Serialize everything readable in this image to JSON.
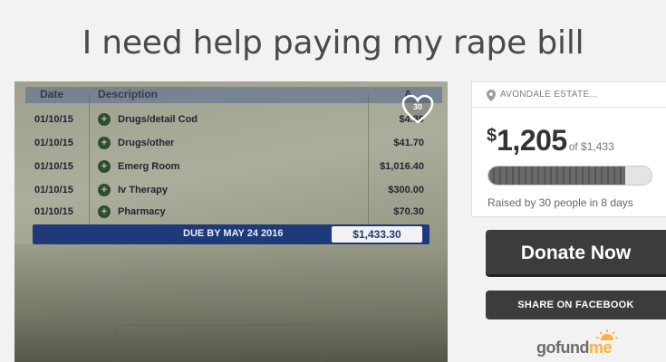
{
  "page": {
    "title": "I need help paying my rape bill"
  },
  "photo": {
    "heart_count": "30",
    "bill": {
      "header": {
        "date": "Date",
        "description": "Description",
        "amount": "A"
      },
      "rows": [
        {
          "date": "01/10/15",
          "description": "Drugs/detail Cod",
          "amount": "$4.30"
        },
        {
          "date": "01/10/15",
          "description": "Drugs/other",
          "amount": "$41.70"
        },
        {
          "date": "01/10/15",
          "description": "Emerg Room",
          "amount": "$1,016.40"
        },
        {
          "date": "01/10/15",
          "description": "Iv Therapy",
          "amount": "$300.00"
        },
        {
          "date": "01/10/15",
          "description": "Pharmacy",
          "amount": "$70.30"
        }
      ],
      "due_label": "DUE BY MAY 24 2016",
      "due_amount": "$1,433.30"
    }
  },
  "sidebar": {
    "location": "AVONDALE ESTATE...",
    "currency": "$",
    "raised_amount": "1,205",
    "goal_text": "of $1,433",
    "progress_fraction": 0.84,
    "raised_by_text": "Raised by 30 people in 8 days",
    "donate_label": "Donate Now",
    "share_label": "SHARE ON FACEBOOK",
    "logo_go": "gofund",
    "logo_me": "me"
  },
  "colors": {
    "button_bg": "#3c3c3c",
    "logo_accent": "#fbb03b",
    "bill_due_bar": "#1f3a7a"
  },
  "icons": {
    "location": "map-pin-icon",
    "heart": "heart-icon",
    "logo_sun": "sun-icon"
  }
}
